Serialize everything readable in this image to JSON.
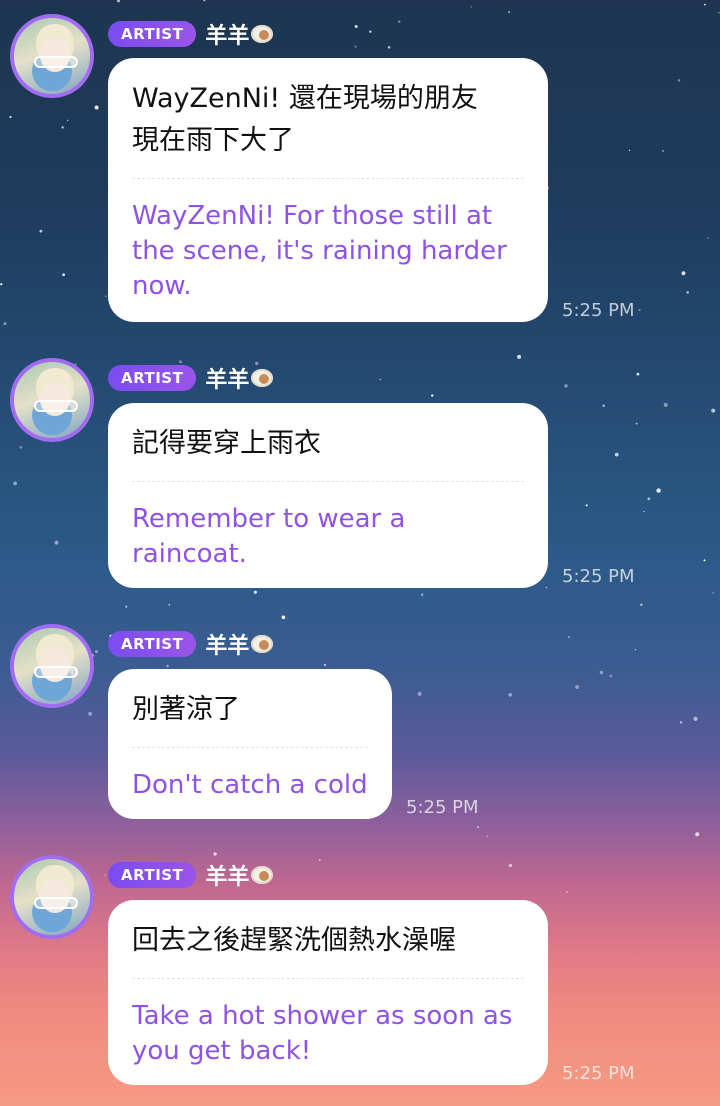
{
  "messages": [
    {
      "badge": "ARTIST",
      "sender": "羊羊",
      "original": "WayZenNi! 還在現場的朋友\n現在雨下大了",
      "translation": "WayZenNi! For those still at\nthe scene, it's raining harder\nnow.",
      "time": "5:25 PM"
    },
    {
      "badge": "ARTIST",
      "sender": "羊羊",
      "original": "記得要穿上雨衣",
      "translation": "Remember to wear a\nraincoat.",
      "time": "5:25 PM"
    },
    {
      "badge": "ARTIST",
      "sender": "羊羊",
      "original": "別著涼了",
      "translation": "Don't catch a cold",
      "time": "5:25 PM"
    },
    {
      "badge": "ARTIST",
      "sender": "羊羊",
      "original": "回去之後趕緊洗個熱水澡喔",
      "translation": "Take a hot shower as soon as\nyou get back!",
      "time": "5:25 PM"
    }
  ],
  "colors": {
    "badge": "#8a50ee",
    "translation_text": "#8f52e6",
    "avatar_ring": "#a26cf0"
  },
  "icons": {
    "sender_suffix": "sheep-icon"
  }
}
